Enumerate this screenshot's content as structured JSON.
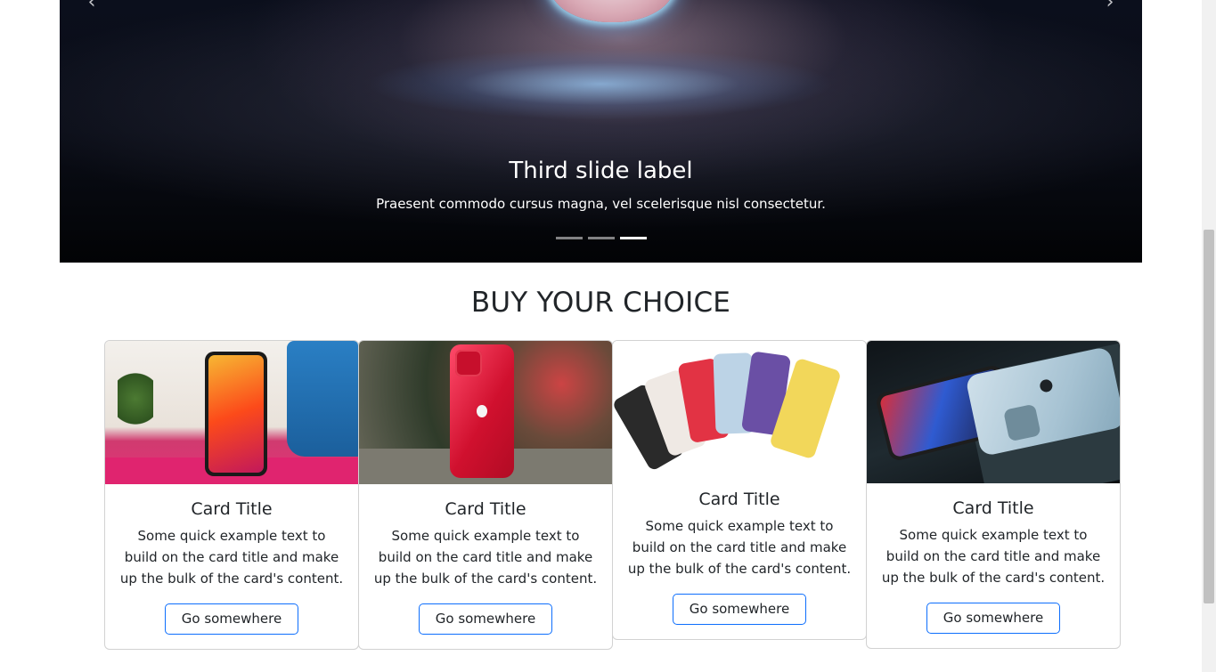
{
  "carousel": {
    "slide_label": "Third slide label",
    "slide_text": "Praesent commodo cursus magna, vel scelerisque nisl consectetur.",
    "prev_icon": "chevron-left-icon",
    "next_icon": "chevron-right-icon",
    "prev_glyph": "‹",
    "next_glyph": "›",
    "active_slide": 3,
    "total_slides": 3
  },
  "section": {
    "title": "BUY YOUR CHOICE"
  },
  "cards": [
    {
      "title": "Card Title",
      "text": "Some quick example text to build on the card title and make up the bulk of the card's content.",
      "button": "Go somewhere"
    },
    {
      "title": "Card Title",
      "text": "Some quick example text to build on the card title and make up the bulk of the card's content.",
      "button": "Go somewhere"
    },
    {
      "title": "Card Title",
      "text": "Some quick example text to build on the card title and make up the bulk of the card's content.",
      "button": "Go somewhere"
    },
    {
      "title": "Card Title",
      "text": "Some quick example text to build on the card title and make up the bulk of the card's content.",
      "button": "Go somewhere"
    }
  ],
  "colors": {
    "button_border": "#0d6efd",
    "text": "#212529",
    "carousel_bg": "#03060f"
  }
}
